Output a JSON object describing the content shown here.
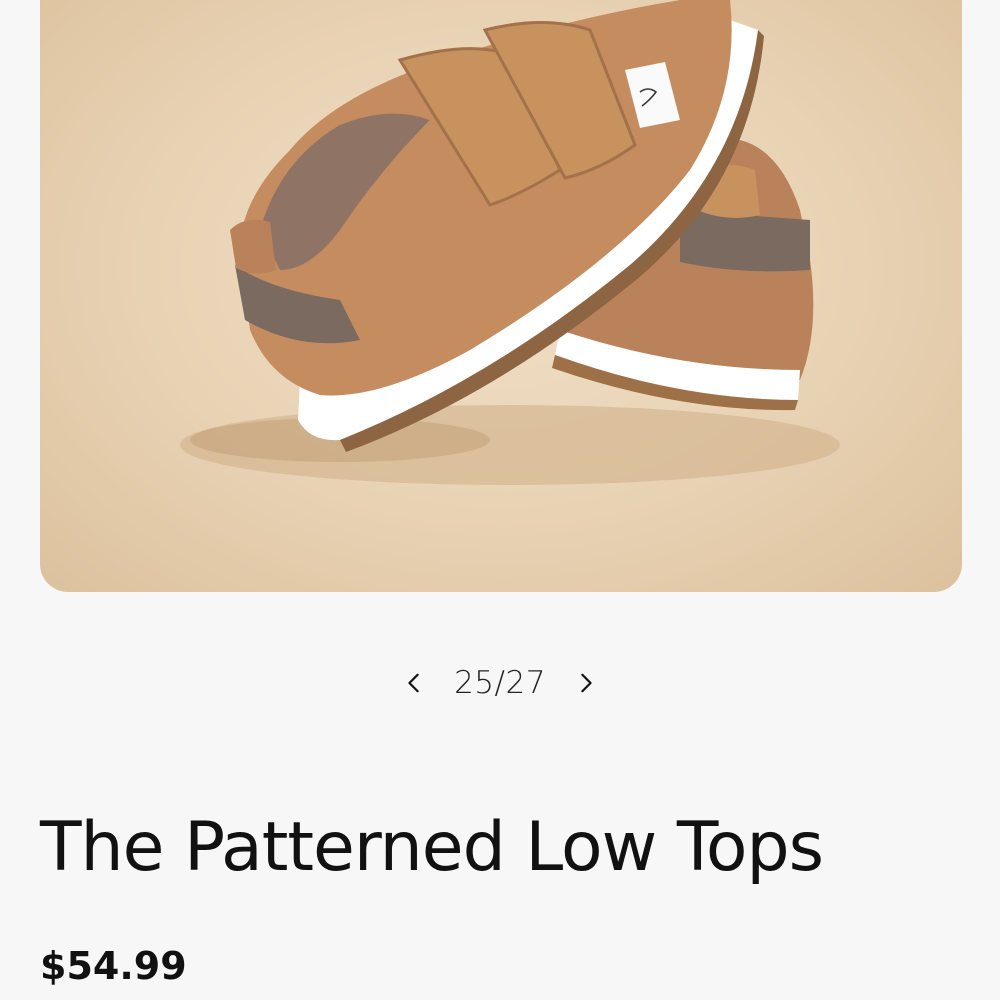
{
  "product": {
    "title": "The Patterned Low Tops",
    "price": "$54.99"
  },
  "gallery": {
    "image_alt": "Tan leather baby sneakers with double hook-and-loop straps",
    "counter": "25/27",
    "current": 25,
    "total": 27,
    "prev_icon": "chevron-left-icon",
    "next_icon": "chevron-right-icon"
  },
  "colors": {
    "page_background": "#f7f7f7",
    "leather": "#c18a5e",
    "suede_accent": "#7b6a5f",
    "sole": "#ffffff",
    "text": "#111111"
  }
}
